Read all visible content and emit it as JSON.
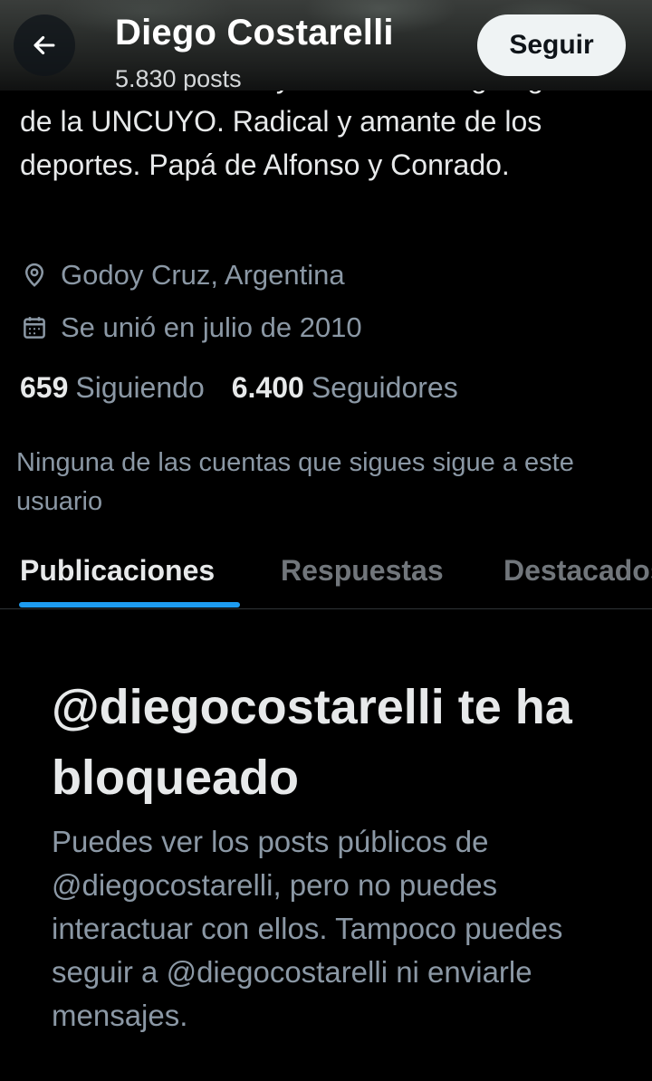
{
  "header": {
    "back_icon": "arrow-left-icon",
    "name": "Diego Costarelli",
    "posts": "5.830 posts",
    "follow_label": "Seguir"
  },
  "profile": {
    "bio": "Intendente de Godoy Cruz. Politólogo egresado de la UNCUYO. Radical y amante de los deportes. Papá de Alfonso y Conrado.",
    "location_icon": "location-pin-icon",
    "location": "Godoy Cruz, Argentina",
    "joined_icon": "calendar-icon",
    "joined": "Se unió en julio de 2010",
    "following_count": "659",
    "following_label": "Siguiendo",
    "followers_count": "6.400",
    "followers_label": "Seguidores",
    "mutual_note": "Ninguna de las cuentas que sigues sigue a este usuario"
  },
  "tabs": [
    {
      "label": "Publicaciones",
      "active": true
    },
    {
      "label": "Respuestas",
      "active": false
    },
    {
      "label": "Destacados",
      "active": false
    }
  ],
  "blocked": {
    "title": "@diegocostarelli te ha bloqueado",
    "description": "Puedes ver los posts públicos de @diegocostarelli, pero no puedes interactuar con ellos. Tampoco puedes seguir a @diegocostarelli ni enviarle mensajes."
  },
  "colors": {
    "background": "#000000",
    "text_primary": "#e7e9ea",
    "text_secondary": "#8b98a5",
    "accent": "#1d9bf0",
    "follow_button_bg": "#eff3f4"
  }
}
